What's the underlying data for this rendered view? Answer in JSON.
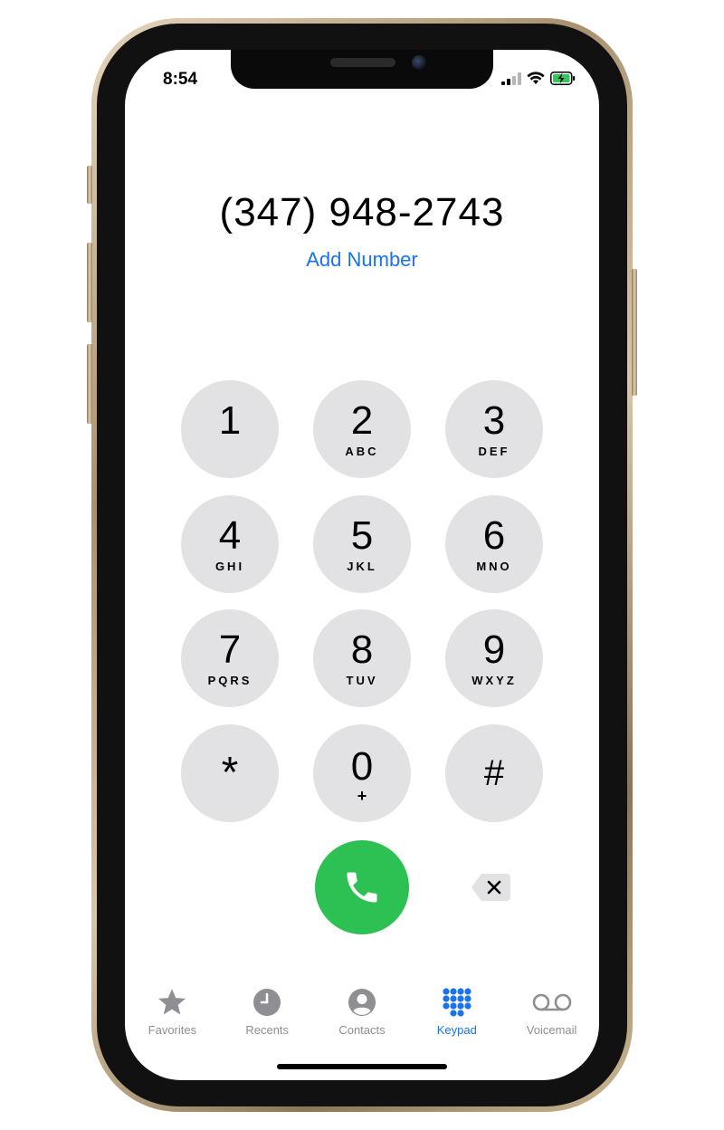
{
  "status_bar": {
    "time": "8:54"
  },
  "dialer": {
    "number": "(347) 948-2743",
    "add_number_label": "Add Number"
  },
  "keypad": {
    "keys": [
      {
        "digit": "1",
        "letters": ""
      },
      {
        "digit": "2",
        "letters": "ABC"
      },
      {
        "digit": "3",
        "letters": "DEF"
      },
      {
        "digit": "4",
        "letters": "GHI"
      },
      {
        "digit": "5",
        "letters": "JKL"
      },
      {
        "digit": "6",
        "letters": "MNO"
      },
      {
        "digit": "7",
        "letters": "PQRS"
      },
      {
        "digit": "8",
        "letters": "TUV"
      },
      {
        "digit": "9",
        "letters": "WXYZ"
      },
      {
        "digit": "*",
        "letters": ""
      },
      {
        "digit": "0",
        "letters": "+"
      },
      {
        "digit": "#",
        "letters": ""
      }
    ]
  },
  "tab_bar": {
    "tabs": [
      {
        "label": "Favorites",
        "icon": "star-icon"
      },
      {
        "label": "Recents",
        "icon": "clock-icon"
      },
      {
        "label": "Contacts",
        "icon": "person-circle-icon"
      },
      {
        "label": "Keypad",
        "icon": "keypad-grid-icon",
        "active": true
      },
      {
        "label": "Voicemail",
        "icon": "voicemail-icon"
      }
    ]
  },
  "colors": {
    "accent": "#1a73e8",
    "call_green": "#2dc052",
    "key_gray": "#e2e2e5",
    "inactive_tab": "#8e8e93"
  }
}
